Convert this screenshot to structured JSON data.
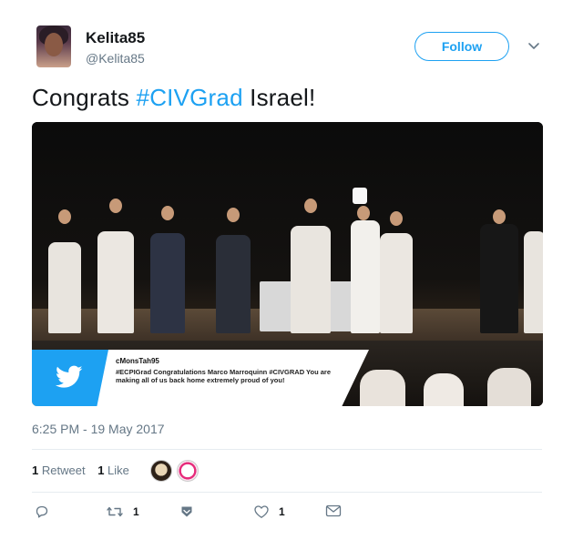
{
  "author": {
    "display_name": "Kelita85",
    "handle": "@Kelita85",
    "avatar_icon": "profile-photo"
  },
  "follow_button": {
    "label": "Follow"
  },
  "more_menu": {
    "icon": "chevron-down-icon"
  },
  "tweet": {
    "text_before": "Congrats ",
    "hashtag": "#CIVGrad",
    "text_after": " Israel!",
    "hashtag_color": "#1da1f2"
  },
  "media": {
    "overlay_user": "cMonsTah95",
    "overlay_message": "#ECPIGrad Congratulations Marco Marroquinn #CIVGRAD You are making all of us back home extremely proud of you!",
    "overlay_icon": "twitter-bird-icon"
  },
  "timestamp": "6:25 PM - 19 May 2017",
  "stats": {
    "retweet_count": "1",
    "retweet_label": "Retweet",
    "like_count": "1",
    "like_label": "Like"
  },
  "actions": {
    "reply_icon": "reply-icon",
    "retweet_icon": "retweet-icon",
    "retweet_count": "1",
    "save_icon": "bookmark-icon",
    "like_icon": "heart-icon",
    "like_count": "1",
    "dm_icon": "envelope-icon"
  },
  "colors": {
    "accent": "#1da1f2",
    "muted": "#657786",
    "text": "#14171a"
  }
}
